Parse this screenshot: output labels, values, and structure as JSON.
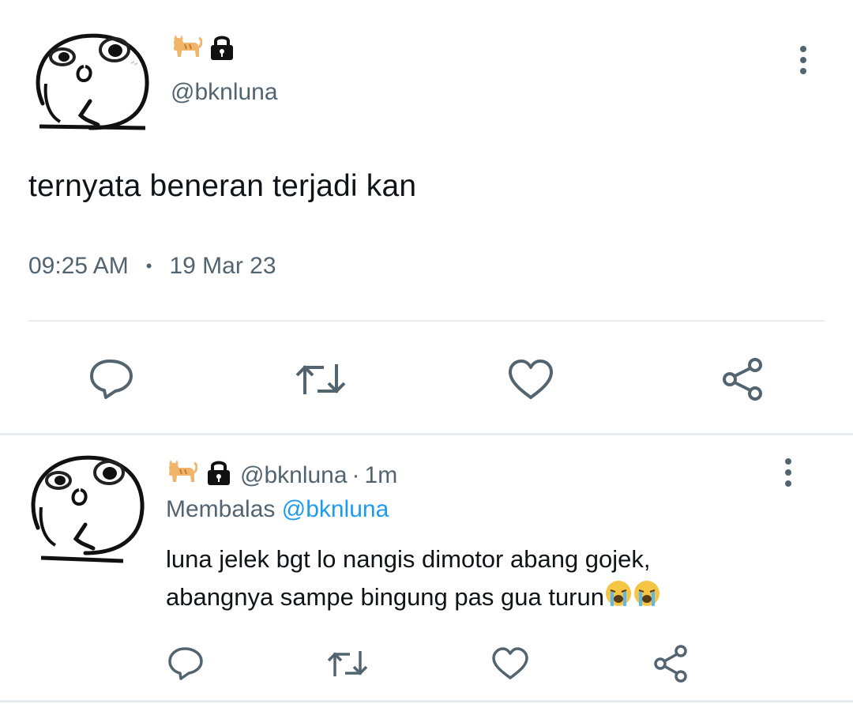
{
  "main_tweet": {
    "handle": "@bknluna",
    "text": "ternyata beneran terjadi kan",
    "time": "09:25 AM",
    "separator": "•",
    "date": "19 Mar 23"
  },
  "reply": {
    "handle": "@bknluna",
    "time_sep": "·",
    "time": "1m",
    "replying_label": "Membalas",
    "replying_to": "@bknluna",
    "text_line1": "luna jelek bgt lo nangis dimotor abang gojek,",
    "text_line2": "abangnya sampe bingung pas gua turun"
  },
  "icons": {
    "name_icons": [
      "cat-icon",
      "lock-icon"
    ],
    "actions": [
      "reply-icon",
      "retweet-icon",
      "like-icon",
      "share-icon"
    ],
    "more": "more-vertical-icon",
    "reply_emoji": [
      "crying-face-icon",
      "crying-face-icon"
    ]
  },
  "colors": {
    "text": "#0f1419",
    "secondary": "#536471",
    "link": "#1d9bf0",
    "divider": "#e6ecf0"
  }
}
